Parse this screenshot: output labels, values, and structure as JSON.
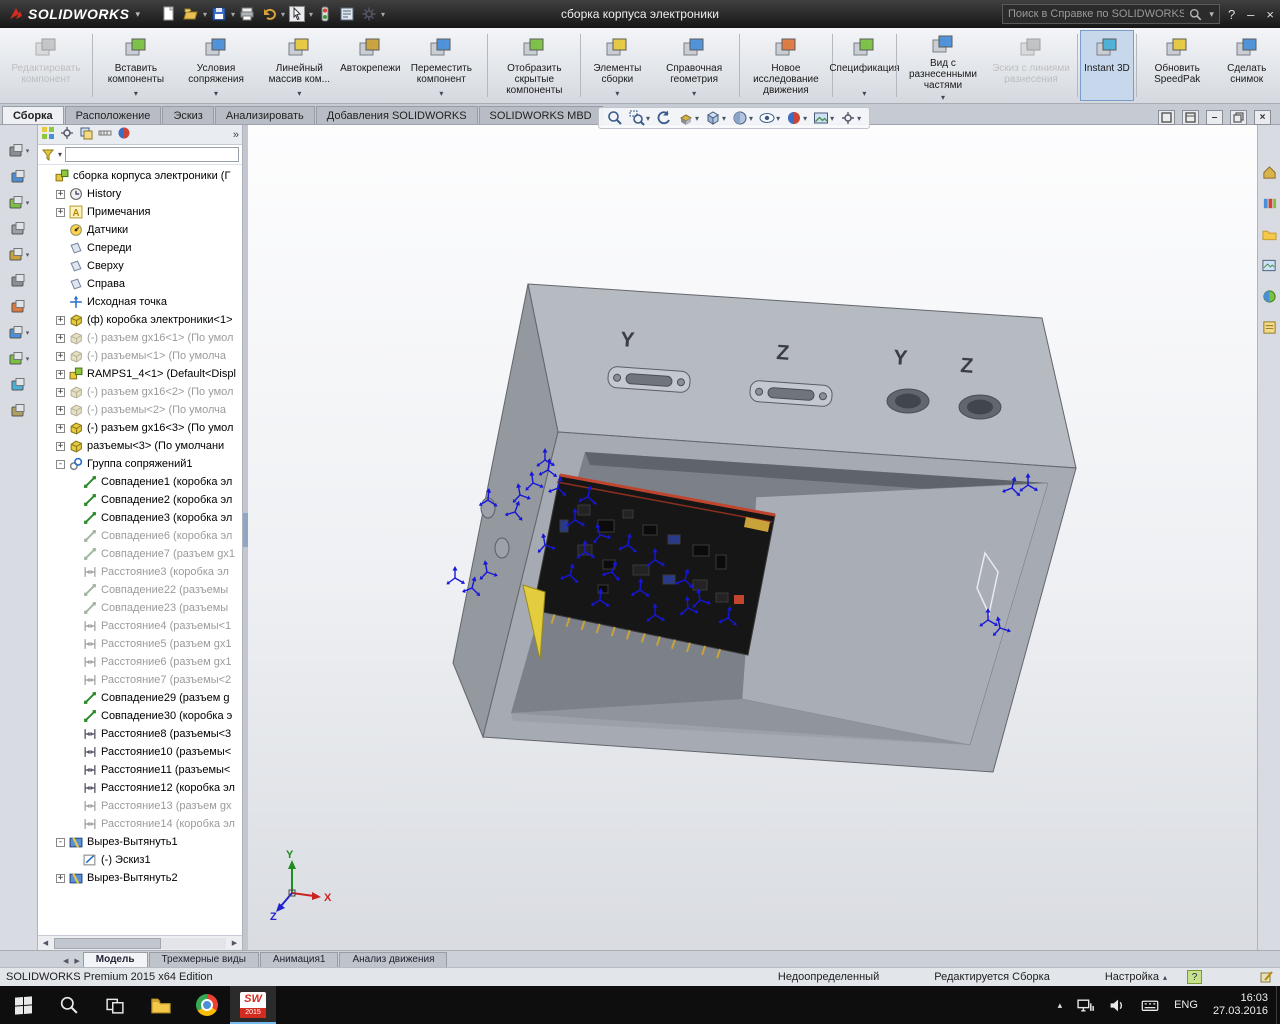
{
  "colors": {
    "accent_blue": "#2a6fc9",
    "mate_blue": "#1616d8",
    "brand_red": "#d42b1f",
    "selection_grip": "#8fa6c4"
  },
  "titlebar": {
    "app_name": "SOLIDWORKS",
    "doc_title": "сборка корпуса электроники",
    "search_placeholder": "Поиск в Справке по SOLIDWORKS",
    "qat_icons": [
      "new-document-icon",
      "open-icon",
      "save-icon",
      "print-icon",
      "undo-icon",
      "select-icon",
      "rebuild-icon",
      "file-properties-icon",
      "options-icon"
    ],
    "window": {
      "help": "?",
      "minimize": "–",
      "close": "×"
    }
  },
  "ribbon": {
    "items": [
      {
        "label": "Редактировать компонент",
        "disabled": true
      },
      {
        "sep": true
      },
      {
        "label": "Вставить компоненты",
        "dropdown": true
      },
      {
        "label": "Условия сопряжения",
        "dropdown": true
      },
      {
        "label": "Линейный массив ком...",
        "dropdown": true
      },
      {
        "label": "Автокрепежи"
      },
      {
        "label": "Переместить компонент",
        "dropdown": true
      },
      {
        "sep": true
      },
      {
        "label": "Отобразить скрытые компоненты"
      },
      {
        "sep": true
      },
      {
        "label": "Элементы сборки",
        "dropdown": true
      },
      {
        "label": "Справочная геометрия",
        "dropdown": true
      },
      {
        "sep": true
      },
      {
        "label": "Новое исследование движения"
      },
      {
        "sep": true
      },
      {
        "label": "Спецификация",
        "dropdown": true
      },
      {
        "sep": true
      },
      {
        "label": "Вид с разнесенными частями",
        "dropdown": true
      },
      {
        "label": "Эскиз с линиями разнесения",
        "disabled": true
      },
      {
        "sep": true
      },
      {
        "label": "Instant 3D",
        "active": true
      },
      {
        "sep": true
      },
      {
        "label": "Обновить SpeedPak"
      },
      {
        "label": "Сделать снимок"
      }
    ]
  },
  "command_tabs": {
    "items": [
      "Сборка",
      "Расположение",
      "Эскиз",
      "Анализировать",
      "Добавления SOLIDWORKS",
      "SOLIDWORKS MBD"
    ],
    "active": 0
  },
  "headsup": {
    "icons": [
      {
        "name": "zoom-fit-icon"
      },
      {
        "name": "zoom-area-icon",
        "dropdown": true
      },
      {
        "name": "previous-view-icon"
      },
      {
        "name": "section-view-icon",
        "dropdown": true
      },
      {
        "name": "view-orientation-icon",
        "dropdown": true
      },
      {
        "name": "display-style-icon",
        "dropdown": true
      },
      {
        "name": "hide-show-items-icon",
        "dropdown": true
      },
      {
        "name": "edit-appearance-icon",
        "dropdown": true
      },
      {
        "name": "scene-icon",
        "dropdown": true
      },
      {
        "name": "view-settings-icon",
        "dropdown": true
      }
    ]
  },
  "doc_window_controls": [
    "doc-properties-button",
    "doc-fullscreen-button",
    "doc-minimize-button",
    "doc-restore-button",
    "doc-close-button"
  ],
  "left_dock": {
    "icons": [
      {
        "name": "clipboard-tool-icon",
        "dropdown": true
      },
      {
        "name": "layers-tool-icon"
      },
      {
        "name": "appearance-ball-icon",
        "dropdown": true
      },
      {
        "name": "camera-tool-icon"
      },
      {
        "name": "component-tool-icon",
        "dropdown": true
      },
      {
        "name": "pattern-tool-icon"
      },
      {
        "name": "palette-tool-icon"
      },
      {
        "name": "grid-dots-icon",
        "dropdown": true
      },
      {
        "name": "measure-tool-icon",
        "dropdown": true
      },
      {
        "name": "curve-tool-icon"
      },
      {
        "name": "note-tool-icon"
      }
    ]
  },
  "feature_panel": {
    "header_tabs": [
      "featuremanager-tab-icon",
      "propertymanager-tab-icon",
      "configurationmanager-tab-icon",
      "dimxpertmanager-tab-icon",
      "displaymanager-tab-icon"
    ],
    "overflow": "»",
    "filter_value": "",
    "tree": [
      {
        "label": "сборка корпуса электроники (Г",
        "level": 0,
        "icon": "root"
      },
      {
        "label": "History",
        "level": 1,
        "icon": "history",
        "exp": "+"
      },
      {
        "label": "Примечания",
        "level": 1,
        "icon": "annot",
        "exp": "+"
      },
      {
        "label": "Датчики",
        "level": 1,
        "icon": "sensors"
      },
      {
        "label": "Спереди",
        "level": 1,
        "icon": "plane"
      },
      {
        "label": "Сверху",
        "level": 1,
        "icon": "plane"
      },
      {
        "label": "Справа",
        "level": 1,
        "icon": "plane"
      },
      {
        "label": "Исходная точка",
        "level": 1,
        "icon": "origin"
      },
      {
        "label": "(ф) коробка электроники<1>",
        "level": 1,
        "icon": "part",
        "exp": "+"
      },
      {
        "label": "(-) разъем gx16<1> (По умол",
        "level": 1,
        "icon": "part",
        "exp": "+",
        "gray": true
      },
      {
        "label": "(-) разъемы<1> (По умолча",
        "level": 1,
        "icon": "part",
        "exp": "+",
        "gray": true
      },
      {
        "label": "RAMPS1_4<1> (Default<Displ",
        "level": 1,
        "icon": "root",
        "exp": "+"
      },
      {
        "label": "(-) разъем gx16<2> (По умол",
        "level": 1,
        "icon": "part",
        "exp": "+",
        "gray": true
      },
      {
        "label": "(-) разъемы<2> (По умолча",
        "level": 1,
        "icon": "part",
        "exp": "+",
        "gray": true
      },
      {
        "label": "(-) разъем gx16<3> (По умол",
        "level": 1,
        "icon": "part",
        "exp": "+"
      },
      {
        "label": "разъемы<3> (По умолчани",
        "level": 1,
        "icon": "part",
        "exp": "+"
      },
      {
        "label": "Группа сопряжений1",
        "level": 1,
        "icon": "mates",
        "exp": "-"
      },
      {
        "label": "Совпадение1 (коробка эл",
        "level": 2,
        "icon": "mate_co"
      },
      {
        "label": "Совпадение2 (коробка эл",
        "level": 2,
        "icon": "mate_co"
      },
      {
        "label": "Совпадение3 (коробка эл",
        "level": 2,
        "icon": "mate_co"
      },
      {
        "label": "Совпадение6 (коробка эл",
        "level": 2,
        "icon": "mate_co",
        "gray": true
      },
      {
        "label": "Совпадение7 (разъем gx1",
        "level": 2,
        "icon": "mate_co",
        "gray": true
      },
      {
        "label": "Расстояние3 (коробка эл",
        "level": 2,
        "icon": "mate_dist",
        "gray": true
      },
      {
        "label": "Совпадение22 (разъемы",
        "level": 2,
        "icon": "mate_co",
        "gray": true
      },
      {
        "label": "Совпадение23 (разъемы",
        "level": 2,
        "icon": "mate_co",
        "gray": true
      },
      {
        "label": "Расстояние4 (разъемы<1",
        "level": 2,
        "icon": "mate_dist",
        "gray": true
      },
      {
        "label": "Расстояние5 (разъем gx1",
        "level": 2,
        "icon": "mate_dist",
        "gray": true
      },
      {
        "label": "Расстояние6 (разъем gx1",
        "level": 2,
        "icon": "mate_dist",
        "gray": true
      },
      {
        "label": "Расстояние7 (разъемы<2",
        "level": 2,
        "icon": "mate_dist",
        "gray": true
      },
      {
        "label": "Совпадение29 (разъем g",
        "level": 2,
        "icon": "mate_co"
      },
      {
        "label": "Совпадение30 (коробка э",
        "level": 2,
        "icon": "mate_co"
      },
      {
        "label": "Расстояние8 (разъемы<3",
        "level": 2,
        "icon": "mate_dist"
      },
      {
        "label": "Расстояние10 (разъемы<",
        "level": 2,
        "icon": "mate_dist"
      },
      {
        "label": "Расстояние11 (разъемы<",
        "level": 2,
        "icon": "mate_dist"
      },
      {
        "label": "Расстояние12 (коробка эл",
        "level": 2,
        "icon": "mate_dist"
      },
      {
        "label": "Расстояние13 (разъем gx",
        "level": 2,
        "icon": "mate_dist",
        "gray": true
      },
      {
        "label": "Расстояние14 (коробка эл",
        "level": 2,
        "icon": "mate_dist",
        "gray": true
      },
      {
        "label": "Вырез-Вытянуть1",
        "level": 1,
        "icon": "cut",
        "exp": "-"
      },
      {
        "label": "(-) Эскиз1",
        "level": 2,
        "icon": "sketch"
      },
      {
        "label": "Вырез-Вытянуть2",
        "level": 1,
        "icon": "cut",
        "exp": "+"
      }
    ]
  },
  "viewport": {
    "top_labels": [
      "Y",
      "Z",
      "Y",
      "Z"
    ],
    "triad": {
      "x": "X",
      "y": "Y",
      "z": "Z"
    }
  },
  "right_dock": {
    "icons": [
      "task-pane-home-icon",
      "design-library-icon",
      "file-explorer-pane-icon",
      "view-palette-icon",
      "appearances-pane-icon",
      "custom-properties-icon"
    ]
  },
  "bottom_tabs": {
    "items": [
      "Модель",
      "Трехмерные виды",
      "Анимация1",
      "Анализ движения"
    ],
    "active": 0
  },
  "statusbar": {
    "left": "SOLIDWORKS Premium 2015 x64 Edition",
    "state": "Недоопределенный",
    "mode": "Редактируется Сборка",
    "custom": "Настройка",
    "help": "?"
  },
  "taskbar": {
    "buttons": [
      "start-button",
      "search-icon",
      "task-view-icon",
      "file-explorer-icon",
      "chrome-icon",
      "solidworks-icon"
    ],
    "solidworks_badge": "2015",
    "sw_letters": "SW",
    "tray_icons": [
      "tray-expand-icon",
      "network-icon",
      "volume-icon",
      "keyboard-icon"
    ],
    "language": "ENG",
    "time": "16:03",
    "date": "27.03.2016"
  }
}
